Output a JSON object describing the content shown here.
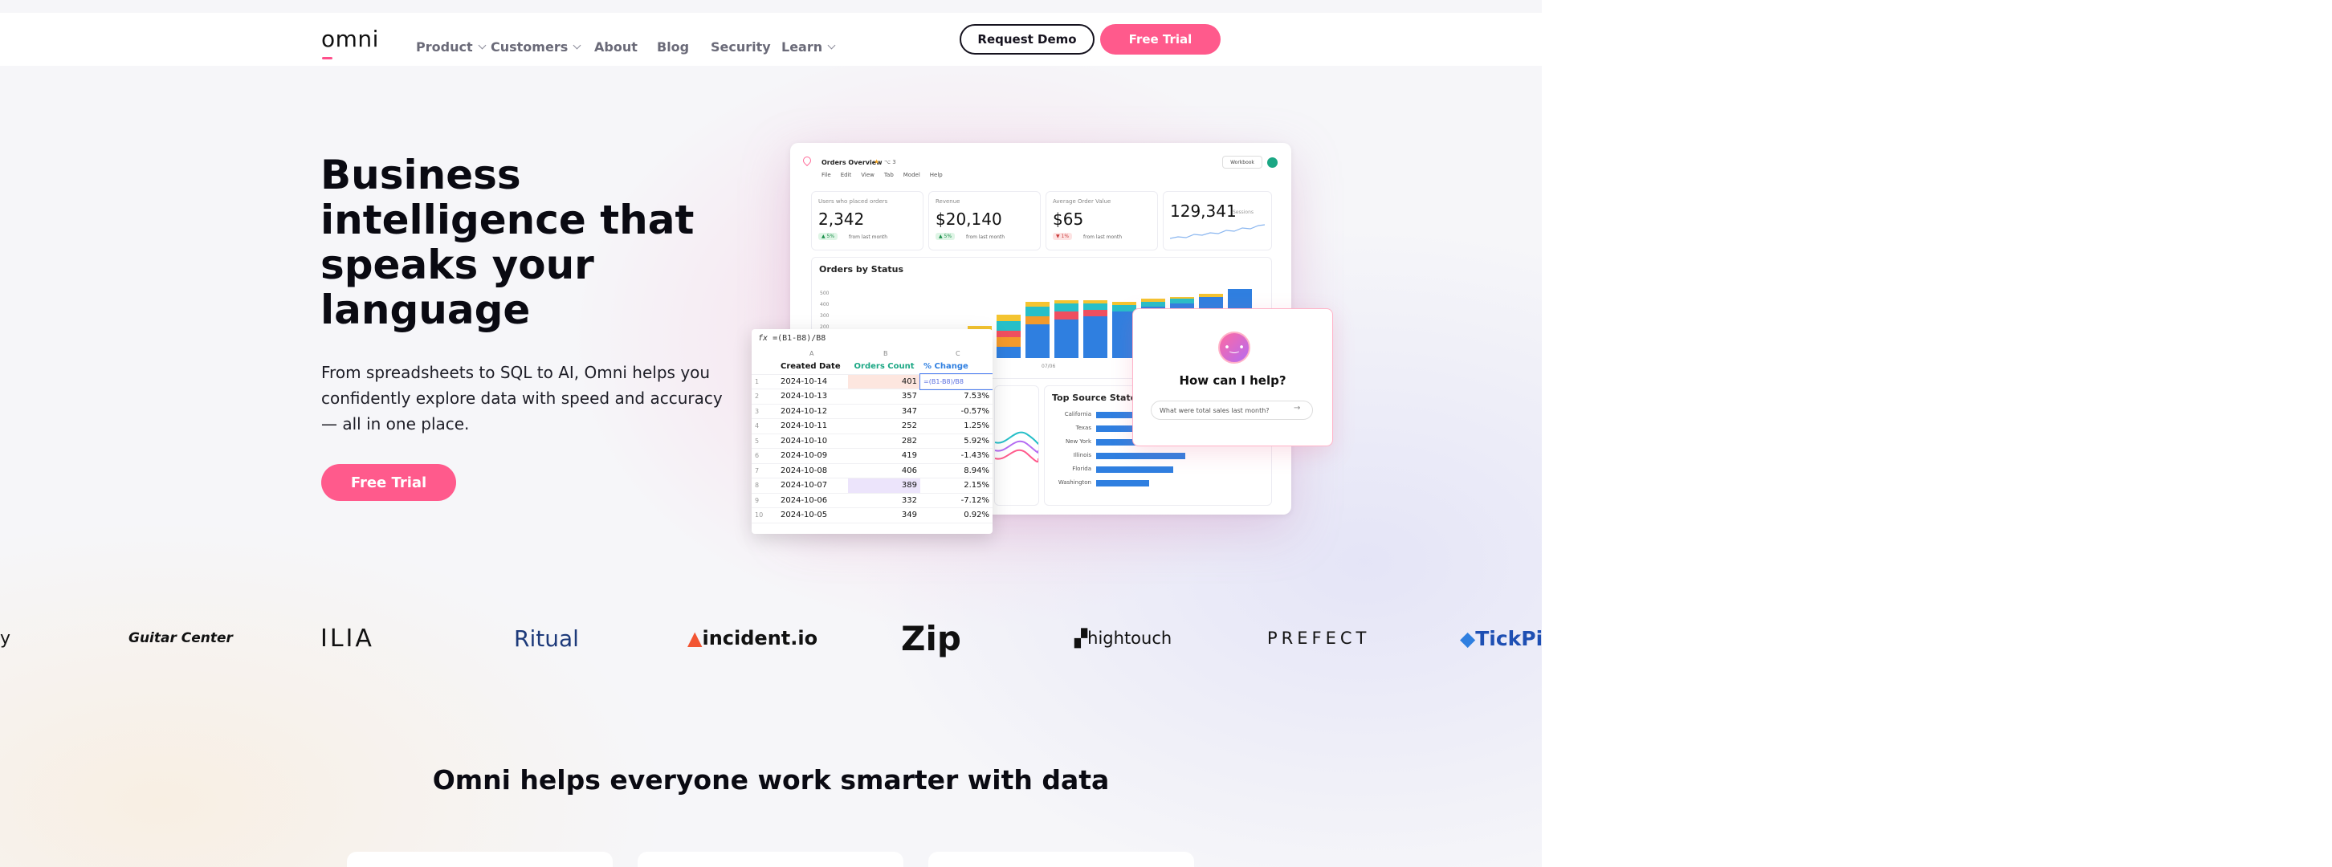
{
  "header": {
    "logo": "omni",
    "nav": [
      {
        "label": "Product",
        "has_dropdown": true
      },
      {
        "label": "Customers",
        "has_dropdown": true
      },
      {
        "label": "About",
        "has_dropdown": false
      },
      {
        "label": "Blog",
        "has_dropdown": false
      },
      {
        "label": "Security",
        "has_dropdown": false
      },
      {
        "label": "Learn",
        "has_dropdown": true
      }
    ],
    "request_demo": "Request Demo",
    "free_trial": "Free Trial"
  },
  "hero": {
    "title": "Business intelligence that speaks your language",
    "subtitle": "From spreadsheets to SQL to AI, Omni helps you confidently explore data with speed and accuracy — all in one place.",
    "cta": "Free Trial"
  },
  "dashboard": {
    "title": "Orders Overview",
    "badge": "3",
    "menu": [
      "File",
      "Edit",
      "View",
      "Tab",
      "Model",
      "Help"
    ],
    "workbook_label": "Workbook",
    "kpis": [
      {
        "label": "Users who placed orders",
        "value": "2,342",
        "delta": "5%",
        "note": "from last month",
        "negative": false
      },
      {
        "label": "Revenue",
        "value": "$20,140",
        "delta": "5%",
        "note": "from last month",
        "negative": false
      },
      {
        "label": "Average Order Value",
        "value": "$65",
        "delta": "1%",
        "note": "from last month",
        "negative": true
      },
      {
        "label": "",
        "value": "129,341",
        "delta": "",
        "note": "Sessions",
        "negative": false
      }
    ],
    "orders_by_status": {
      "title": "Orders by Status",
      "y_ticks": [
        "500",
        "400",
        "300",
        "200"
      ],
      "x_label": "07/06"
    },
    "top_source_states": {
      "title": "Top Source States",
      "states": [
        "California",
        "Texas",
        "New York",
        "Illinois",
        "Florida",
        "Washington"
      ],
      "values": [
        100,
        82,
        70,
        57,
        49,
        34
      ]
    }
  },
  "spreadsheet": {
    "formula_prefix": "fx",
    "formula": "=(B1-B8)/B8",
    "columns": [
      "A",
      "B",
      "C"
    ],
    "headers": [
      "Created Date",
      "Orders Count",
      "% Change"
    ],
    "rows": [
      {
        "n": "1",
        "date": "2024-10-14",
        "orders": "401",
        "change": "=(B1-B8)/B8"
      },
      {
        "n": "2",
        "date": "2024-10-13",
        "orders": "357",
        "change": "7.53%"
      },
      {
        "n": "3",
        "date": "2024-10-12",
        "orders": "347",
        "change": "-0.57%"
      },
      {
        "n": "4",
        "date": "2024-10-11",
        "orders": "252",
        "change": "1.25%"
      },
      {
        "n": "5",
        "date": "2024-10-10",
        "orders": "282",
        "change": "5.92%"
      },
      {
        "n": "6",
        "date": "2024-10-09",
        "orders": "419",
        "change": "-1.43%"
      },
      {
        "n": "7",
        "date": "2024-10-08",
        "orders": "406",
        "change": "8.94%"
      },
      {
        "n": "8",
        "date": "2024-10-07",
        "orders": "389",
        "change": "2.15%"
      },
      {
        "n": "9",
        "date": "2024-10-06",
        "orders": "332",
        "change": "-7.12%"
      },
      {
        "n": "10",
        "date": "2024-10-05",
        "orders": "349",
        "change": "0.92%"
      }
    ]
  },
  "ai_assistant": {
    "title": "How can I help?",
    "placeholder": "What were total sales last month?"
  },
  "logos": [
    "y",
    "Guitar Center",
    "ILIA",
    "Ritual",
    "incident.io",
    "Zip",
    "hightouch",
    "PREFECT",
    "TickPic"
  ],
  "section": {
    "title": "Omni helps everyone work smarter with data"
  },
  "colors": {
    "brand_pink": "#ff5a8c",
    "dark": "#15121e",
    "bar_blue": "#2f7fe0",
    "bar_teal": "#27bfc8",
    "bar_yellow": "#f4c430",
    "bar_orange": "#f39a2b",
    "bar_red": "#ef4f5f"
  }
}
